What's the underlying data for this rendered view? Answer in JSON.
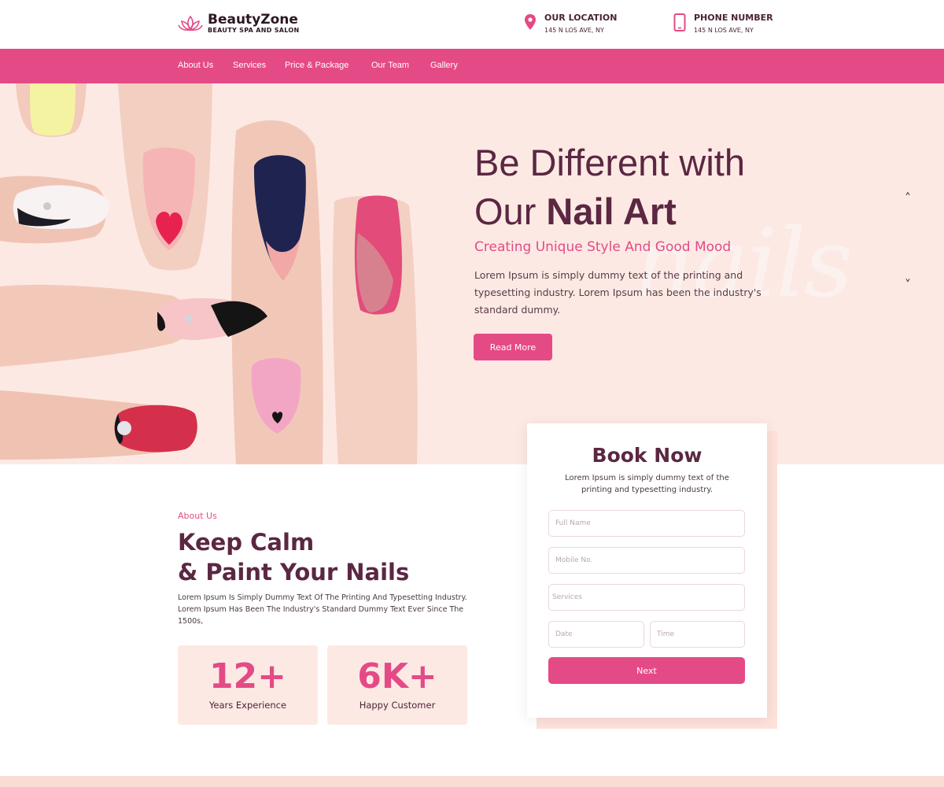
{
  "brand": {
    "name": "BeautyZone",
    "tagline": "BEAUTY SPA AND SALON"
  },
  "contacts": [
    {
      "title": "OUR LOCATION",
      "text": "145 N LOS AVE, NY",
      "icon": "map-pin-icon"
    },
    {
      "title": "PHONE NUMBER",
      "text": "145 N LOS AVE, NY",
      "icon": "phone-icon"
    }
  ],
  "nav": [
    "About Us",
    "Services",
    "Price & Package",
    "Our Team",
    "Gallery"
  ],
  "hero": {
    "title_line1": "Be Different with",
    "title_line2_plain": "Our ",
    "title_line2_bold": "Nail Art",
    "subtitle": "Creating Unique Style And Good Mood",
    "description": "Lorem Ipsum is simply dummy text of the printing and typesetting industry. Lorem Ipsum has been the industry's standard dummy.",
    "button": "Read More",
    "background_word": "nails",
    "prev_arrow": "˄",
    "next_arrow": "˅"
  },
  "booking": {
    "title": "Book Now",
    "description": "Lorem Ipsum is simply dummy text of the printing and typesetting industry.",
    "fields": {
      "name": "Full Name",
      "mobile": "Mobile No.",
      "services": "Services",
      "date": "Date",
      "time": "Time"
    },
    "button": "Next"
  },
  "about": {
    "label": "About Us",
    "title_line1": "Keep Calm",
    "title_line2": "& Paint Your Nails",
    "text": "Lorem Ipsum Is Simply Dummy Text Of The Printing And Typesetting Industry. Lorem Ipsum Has Been The Industry's Standard Dummy Text Ever Since The 1500s,",
    "stats": [
      {
        "number": "12+",
        "label": "Years Experience"
      },
      {
        "number": "6K+",
        "label": "Happy Customer"
      }
    ]
  },
  "colors": {
    "accent": "#e44a86",
    "dark": "#5b2742",
    "hero_bg": "#fde9e4"
  }
}
